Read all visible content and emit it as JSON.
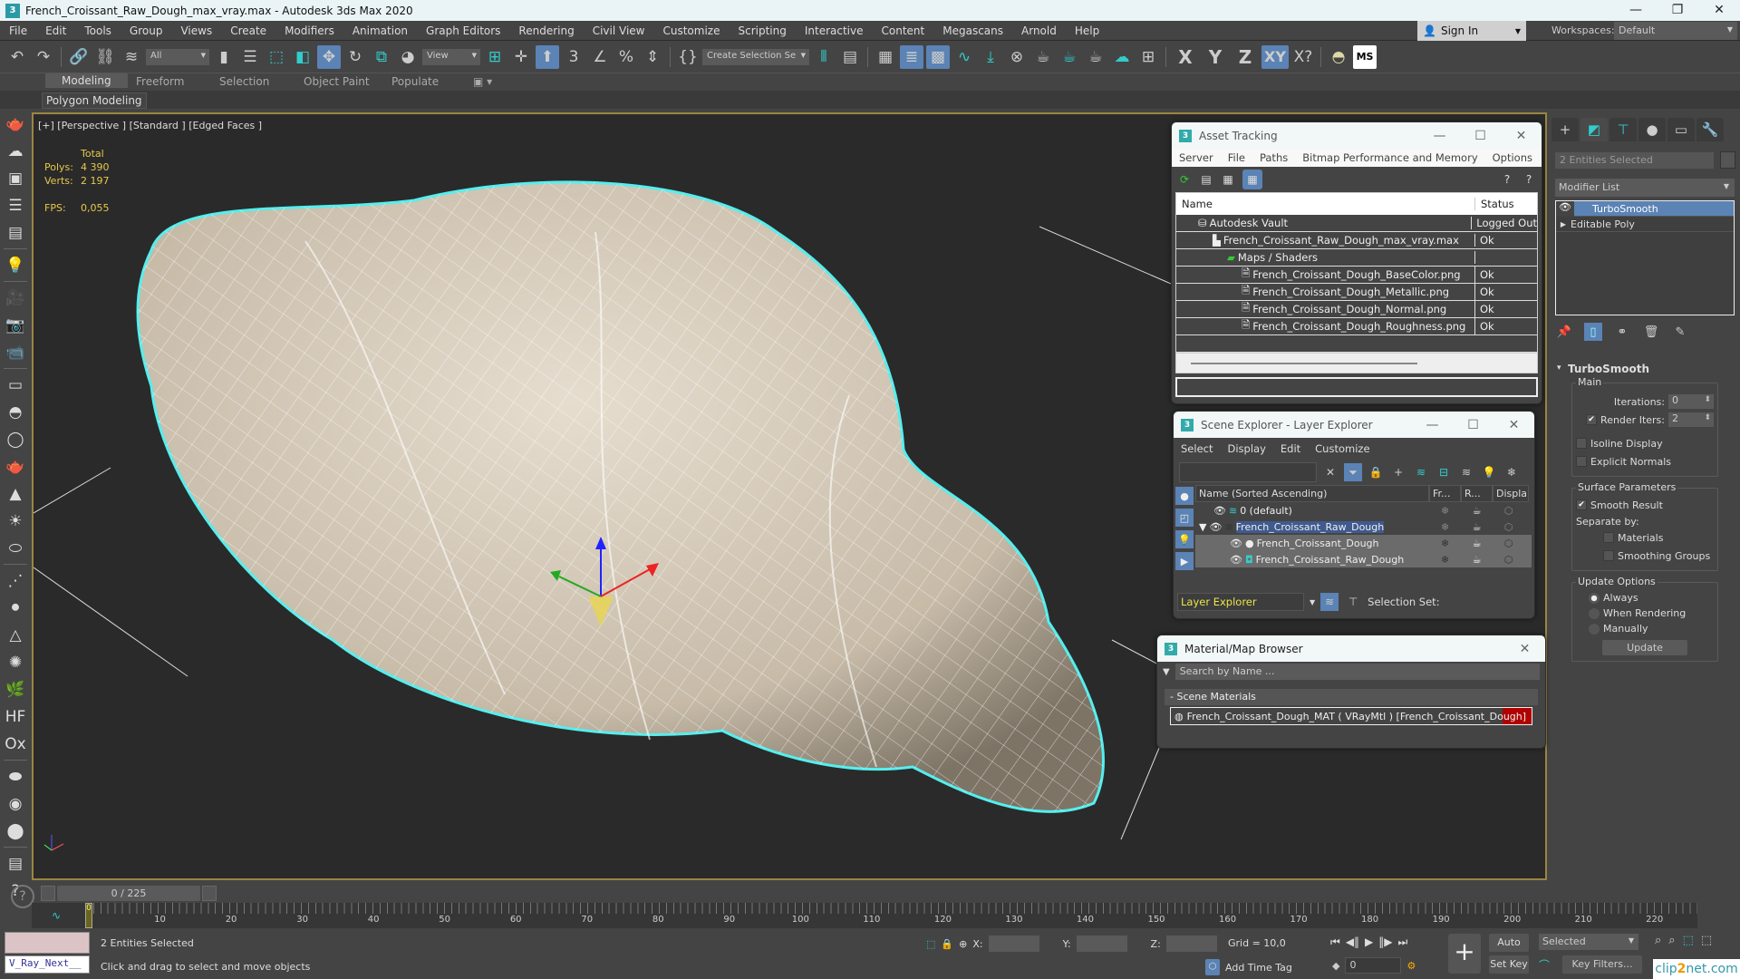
{
  "window": {
    "title": "French_Croissant_Raw_Dough_max_vray.max - Autodesk 3ds Max 2020",
    "app_icon": "3"
  },
  "menubar": {
    "items": [
      "File",
      "Edit",
      "Tools",
      "Group",
      "Views",
      "Create",
      "Modifiers",
      "Animation",
      "Graph Editors",
      "Rendering",
      "Civil View",
      "Customize",
      "Scripting",
      "Interactive",
      "Content",
      "Megascans",
      "Arnold",
      "Help"
    ],
    "sign_in": "Sign In",
    "workspaces_label": "Workspaces:",
    "workspace_value": "Default"
  },
  "toolbar": {
    "selection_filter": "All",
    "ref_coord": "View",
    "named_selection": "Create Selection Se",
    "axis": [
      "X",
      "Y",
      "Z",
      "XY"
    ],
    "active_axis": "XY"
  },
  "ribbon": {
    "tabs": [
      "Modeling",
      "Freeform",
      "Selection",
      "Object Paint",
      "Populate"
    ],
    "active_tab": "Modeling",
    "sub_label": "Polygon Modeling"
  },
  "viewport": {
    "label": "[+] [Perspective ] [Standard ] [Edged Faces ]",
    "stats": {
      "header": "Total",
      "polys_label": "Polys:",
      "polys": "4 390",
      "verts_label": "Verts:",
      "verts": "2 197",
      "fps_label": "FPS:",
      "fps": "0,055"
    }
  },
  "asset_tracking": {
    "title": "Asset Tracking",
    "menu": [
      "Server",
      "File",
      "Paths",
      "Bitmap Performance and Memory",
      "Options"
    ],
    "columns": [
      "Name",
      "Status"
    ],
    "rows": [
      {
        "name": "Autodesk Vault",
        "status": "Logged Out",
        "indent": 1,
        "icon": "vault-icon"
      },
      {
        "name": "French_Croissant_Raw_Dough_max_vray.max",
        "status": "Ok",
        "indent": 2,
        "icon": "max-file-icon"
      },
      {
        "name": "Maps / Shaders",
        "status": "",
        "indent": 3,
        "icon": "maps-icon"
      },
      {
        "name": "French_Croissant_Dough_BaseColor.png",
        "status": "Ok",
        "indent": 4,
        "icon": "image-file-icon"
      },
      {
        "name": "French_Croissant_Dough_Metallic.png",
        "status": "Ok",
        "indent": 4,
        "icon": "image-file-icon"
      },
      {
        "name": "French_Croissant_Dough_Normal.png",
        "status": "Ok",
        "indent": 4,
        "icon": "image-file-icon"
      },
      {
        "name": "French_Croissant_Dough_Roughness.png",
        "status": "Ok",
        "indent": 4,
        "icon": "image-file-icon"
      }
    ]
  },
  "scene_explorer": {
    "title": "Scene Explorer - Layer Explorer",
    "menu": [
      "Select",
      "Display",
      "Edit",
      "Customize"
    ],
    "columns": [
      "Name (Sorted Ascending)",
      "Fr...",
      "R...",
      "Displa..."
    ],
    "rows": [
      {
        "name": "0 (default)",
        "level": 0,
        "type": "layer"
      },
      {
        "name": "French_Croissant_Raw_Dough",
        "level": 0,
        "type": "layer",
        "selected": true,
        "expanded": true
      },
      {
        "name": "French_Croissant_Dough",
        "level": 1,
        "type": "object"
      },
      {
        "name": "French_Croissant_Raw_Dough",
        "level": 1,
        "type": "group"
      }
    ],
    "explorer_mode": "Layer Explorer",
    "selection_set_label": "Selection Set:"
  },
  "material_browser": {
    "title": "Material/Map Browser",
    "search_placeholder": "Search by Name ...",
    "category": "- Scene Materials",
    "items": [
      "French_Croissant_Dough_MAT ( VRayMtl ) [French_Croissant_Dough]"
    ]
  },
  "command_panel": {
    "selection_name": "2 Entities Selected",
    "modifier_list": "Modifier List",
    "stack": [
      {
        "name": "TurboSmooth",
        "selected": true
      },
      {
        "name": "Editable Poly",
        "selected": false
      }
    ],
    "rollout": {
      "title": "TurboSmooth",
      "main_label": "Main",
      "iterations_label": "Iterations:",
      "iterations": "0",
      "render_iters_label": "Render Iters:",
      "render_iters": "2",
      "render_iters_checked": true,
      "isoline_label": "Isoline Display",
      "isoline_checked": false,
      "explicit_label": "Explicit Normals",
      "explicit_checked": false,
      "surface_label": "Surface Parameters",
      "smooth_result_label": "Smooth Result",
      "smooth_result_checked": true,
      "separate_label": "Separate by:",
      "materials_label": "Materials",
      "smoothing_groups_label": "Smoothing Groups",
      "update_label": "Update Options",
      "always_label": "Always",
      "when_rendering_label": "When Rendering",
      "manually_label": "Manually",
      "update_option": "Always",
      "update_button": "Update"
    }
  },
  "timeline": {
    "frame_display": "0 / 225",
    "current_frame": 0,
    "total_frames": 225,
    "tick_labels": [
      "0",
      "10",
      "20",
      "30",
      "40",
      "50",
      "60",
      "70",
      "80",
      "90",
      "100",
      "110",
      "120",
      "130",
      "140",
      "150",
      "160",
      "170",
      "180",
      "190",
      "200",
      "210",
      "220"
    ]
  },
  "statusbar": {
    "maxscript_value": "V_Ray_Next__",
    "selection_status": "2 Entities Selected",
    "prompt": "Click and drag to select and move objects",
    "x_label": "X:",
    "y_label": "Y:",
    "z_label": "Z:",
    "grid": "Grid = 10,0",
    "add_time_tag": "Add Time Tag",
    "frame_field": "0",
    "auto_key": "Auto Key",
    "set_key": "Set Key",
    "key_mode": "Selected",
    "key_filters": "Key Filters...",
    "watermark_a": "clip",
    "watermark_b": "2",
    "watermark_c": "net.com"
  }
}
